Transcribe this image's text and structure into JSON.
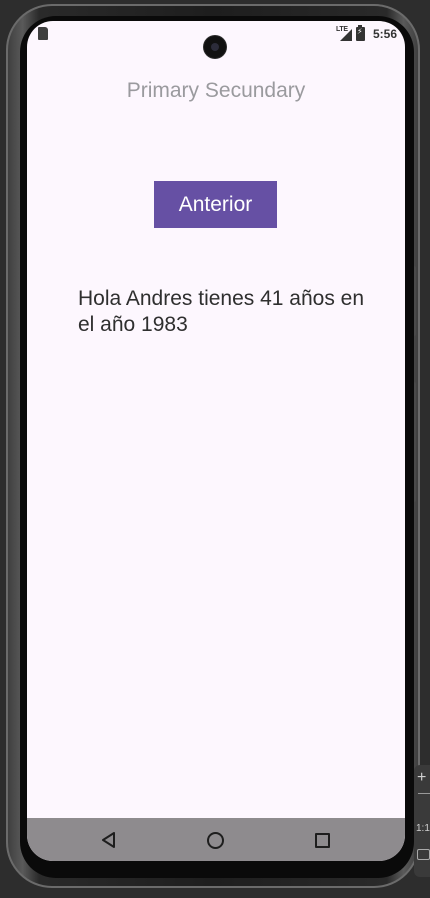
{
  "status_bar": {
    "time": "5:56",
    "network_label": "LTE",
    "icons": [
      "sd-card-icon",
      "signal-icon",
      "battery-charging-icon"
    ]
  },
  "app": {
    "title": "Primary Secundary",
    "button_label": "Anterior",
    "message": "Hola Andres tienes 41 años en el año 1983"
  },
  "nav_bar": {
    "icons": [
      "back-icon",
      "home-icon",
      "recents-icon"
    ]
  },
  "emulator_toolbar": {
    "zoom_in": "+",
    "ratio_label": "1:1"
  },
  "colors": {
    "screen_background": "#fdf7fe",
    "button_background": "#6650a4",
    "button_text": "#ffffff",
    "title_text": "#9a9a9e",
    "nav_bar_background": "#8e8b8e"
  }
}
